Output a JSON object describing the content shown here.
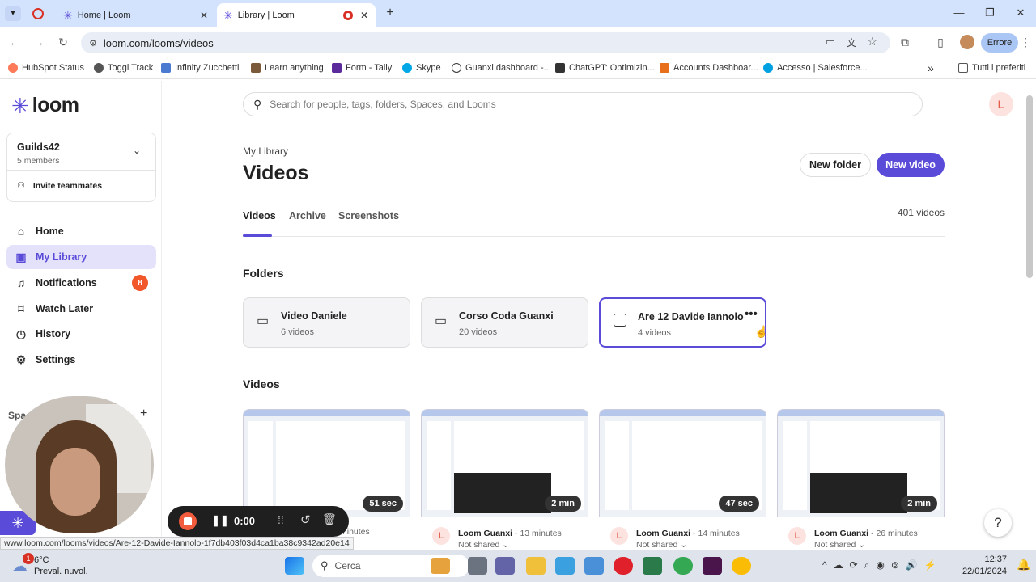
{
  "browser": {
    "tabs": [
      {
        "title": "Home | Loom",
        "active": false
      },
      {
        "title": "Library | Loom",
        "active": true
      }
    ],
    "new_tab_symbol": "+",
    "url": "loom.com/looms/videos",
    "profile_label": "Errore",
    "bookmarks": [
      {
        "label": "HubSpot Status",
        "icon": "hubspot-icon",
        "color": "#ff7a59"
      },
      {
        "label": "Toggl Track",
        "icon": "toggl-icon",
        "color": "#555555"
      },
      {
        "label": "Infinity Zucchetti",
        "icon": "infinity-icon",
        "color": "#4a7bd0"
      },
      {
        "label": "Learn anything",
        "icon": "learn-icon",
        "color": "#7a5a3a"
      },
      {
        "label": "Form - Tally",
        "icon": "tally-icon",
        "color": "#5b2a9b"
      },
      {
        "label": "Skype",
        "icon": "skype-icon",
        "color": "#00a7e7"
      },
      {
        "label": "Guanxi dashboard -...",
        "icon": "google-icon",
        "color": "#333333"
      },
      {
        "label": "ChatGPT: Optimizin...",
        "icon": "chatgpt-icon",
        "color": "#333333"
      },
      {
        "label": "Accounts Dashboar...",
        "icon": "accounts-icon",
        "color": "#e8701a"
      },
      {
        "label": "Accesso | Salesforce...",
        "icon": "salesforce-icon",
        "color": "#00a1e0"
      }
    ],
    "bookmarks_overflow": "»",
    "all_bookmarks": "Tutti i preferiti",
    "status_url": "www.loom.com/looms/videos/Are-12-Davide-Iannolo-1f7db403f03d4ca1ba38c9342ad20e14"
  },
  "sidebar": {
    "logo_text": "loom",
    "workspace": {
      "name": "Guilds42",
      "members": "5 members"
    },
    "invite_label": "Invite teammates",
    "nav": [
      {
        "label": "Home",
        "icon": "home-icon",
        "selected": false
      },
      {
        "label": "My Library",
        "icon": "library-icon",
        "selected": true
      },
      {
        "label": "Notifications",
        "icon": "bell-icon",
        "selected": false,
        "badge": "8"
      },
      {
        "label": "Watch Later",
        "icon": "bookmark-icon",
        "selected": false
      },
      {
        "label": "History",
        "icon": "clock-icon",
        "selected": false
      },
      {
        "label": "Settings",
        "icon": "gear-icon",
        "selected": false
      }
    ],
    "spaces_label": "Spac",
    "spaces_add": "+"
  },
  "main": {
    "search_placeholder": "Search for people, tags, folders, Spaces, and Looms",
    "avatar_letter": "L",
    "breadcrumb": "My Library",
    "title": "Videos",
    "new_folder_label": "New folder",
    "new_video_label": "New video",
    "tabs": [
      {
        "label": "Videos",
        "active": true
      },
      {
        "label": "Archive",
        "active": false
      },
      {
        "label": "Screenshots",
        "active": false
      }
    ],
    "video_count": "401 videos",
    "folders_heading": "Folders",
    "folders": [
      {
        "name": "Video Daniele",
        "count": "6 videos"
      },
      {
        "name": "Corso Coda Guanxi",
        "count": "20 videos"
      },
      {
        "name": "Are 12 Davide Iannolo",
        "count": "4 videos"
      }
    ],
    "videos_heading": "Videos",
    "videos": [
      {
        "duration": "51 sec",
        "author": "",
        "ago": "minutes",
        "shared": ""
      },
      {
        "duration": "2 min",
        "author": "Loom Guanxi",
        "ago": "13 minutes",
        "shared": "Not shared"
      },
      {
        "duration": "47 sec",
        "author": "Loom Guanxi",
        "ago": "14 minutes",
        "shared": "Not shared"
      },
      {
        "duration": "2 min",
        "author": "Loom Guanxi",
        "ago": "26 minutes",
        "shared": "Not shared"
      }
    ],
    "help_symbol": "?"
  },
  "recorder": {
    "timer": "0:00"
  },
  "taskbar": {
    "weather_temp": "6°C",
    "weather_desc": "Preval. nuvol.",
    "weather_badge": "1",
    "search_label": "Cerca",
    "time": "12:37",
    "date": "22/01/2024"
  },
  "colors": {
    "accent": "#5a4bd8",
    "badge": "#f2572a"
  }
}
